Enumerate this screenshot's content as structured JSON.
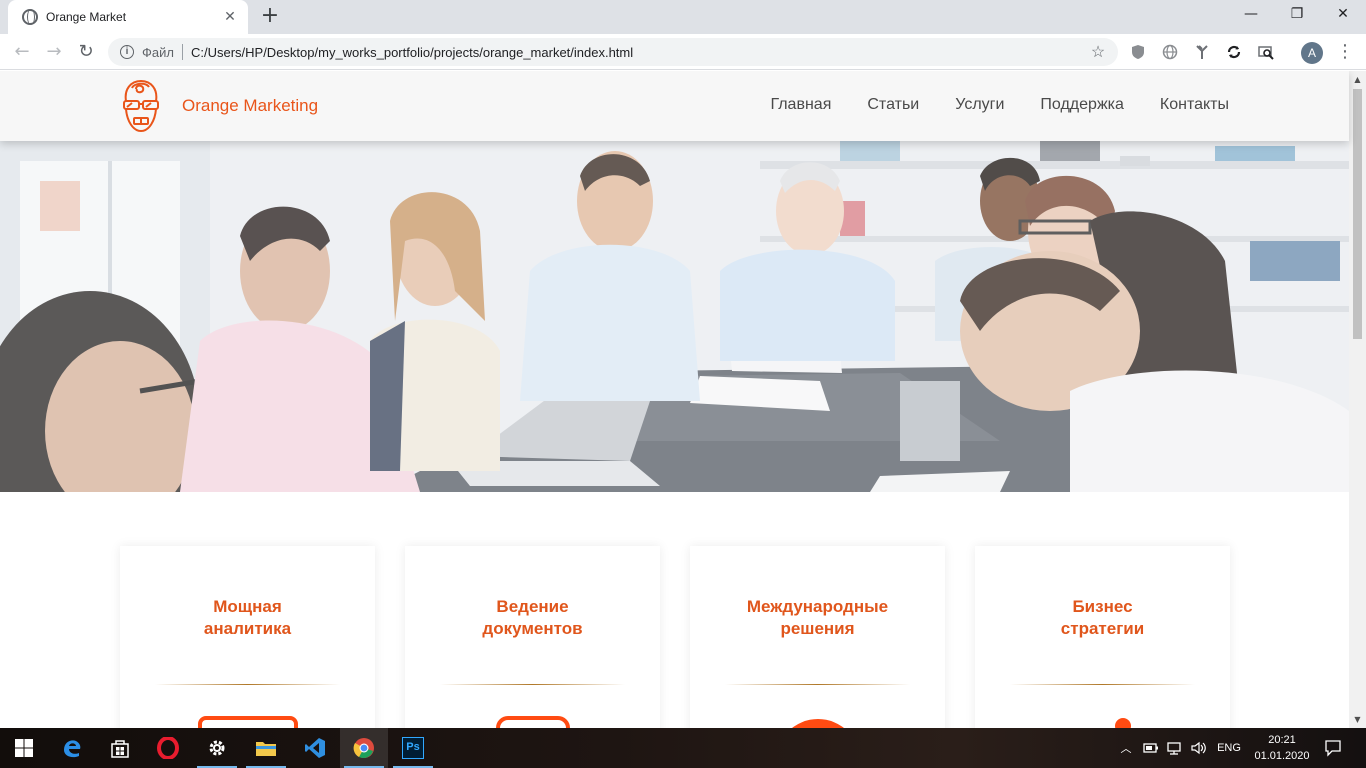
{
  "browser": {
    "tab_title": "Orange Market",
    "close_glyph": "✕",
    "new_tab_glyph": "+",
    "window": {
      "minimize": "—",
      "restore": "❐",
      "close": "✕"
    },
    "back_glyph": "←",
    "forward_glyph": "→",
    "reload_glyph": "↻",
    "info_glyph": "i",
    "omni_label": "Файл",
    "url": "C:/Users/HP/Desktop/my_works_portfolio/projects/orange_market/index.html",
    "star_glyph": "☆",
    "extensions": [
      "shield-icon",
      "globe-icon",
      "antenna-icon",
      "sync-icon",
      "search-page-icon"
    ],
    "profile_initial": "A",
    "menu_glyph": "⋮"
  },
  "site": {
    "brand": "Orange Marketing",
    "accent_color": "#e9551a",
    "nav": [
      "Главная",
      "Статьи",
      "Услуги",
      "Поддержка",
      "Контакты"
    ],
    "hero_alt": "team-meeting-photo",
    "cards": [
      {
        "title_l1": "Мощная",
        "title_l2": "аналитика",
        "icon": "monitor-icon"
      },
      {
        "title_l1": "Ведение",
        "title_l2": "документов",
        "icon": "document-icon"
      },
      {
        "title_l1": "Международные",
        "title_l2": "решения",
        "icon": "globe-icon"
      },
      {
        "title_l1": "Бизнес",
        "title_l2": "стратегии",
        "icon": "strategy-icon"
      }
    ]
  },
  "scrollbar": {
    "up": "▲",
    "down": "▼"
  },
  "taskbar": {
    "apps": [
      "windows-start-icon",
      "edge-icon",
      "store-icon",
      "opera-icon",
      "settings-icon",
      "explorer-icon",
      "vscode-icon",
      "chrome-icon",
      "photoshop-icon"
    ],
    "ps_label": "Ps",
    "tray_chevron": "︿",
    "lang": "ENG",
    "time": "20:21",
    "date": "01.01.2020",
    "notifications_glyph": "🗨"
  }
}
